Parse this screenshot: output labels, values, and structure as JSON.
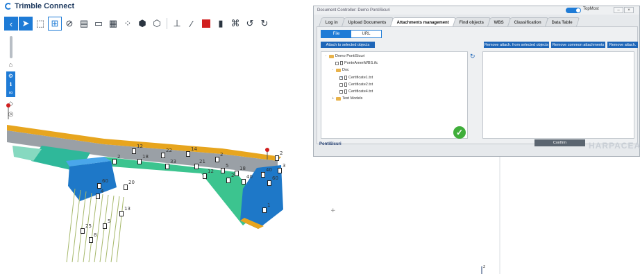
{
  "app": {
    "title": "Trimble Connect"
  },
  "toolbar": {
    "icons": [
      "chevron-left-icon",
      "pointer-icon",
      "box-select-icon",
      "object-select-icon",
      "hide-icon",
      "clip-icon",
      "measure-icon",
      "grid-icon",
      "explode-icon",
      "paint-icon",
      "cube-icon",
      "ruler-icon",
      "pen-icon",
      "color-icon",
      "layers-icon",
      "markup-icon",
      "undo-icon",
      "redo-icon"
    ],
    "color_swatch": "#d11f1f"
  },
  "dialog": {
    "title": "Document Controller: Demo PontiSicuri",
    "topmost_label": "TopMost",
    "tabs": [
      "Log in",
      "Upload Documents",
      "Attachments management",
      "Find objects",
      "WBS",
      "Classification",
      "Data Table"
    ],
    "active_tab": "Attachments management",
    "segment": {
      "file": "File",
      "url": "URL"
    },
    "attach_button": "Attach to selected objects",
    "remove_selected_button": "Remove attach. from selected objects",
    "remove_common_button": "Remove common attachments",
    "remove_button": "Remove attach.",
    "tree": [
      {
        "label": "Demo PontiSicuri",
        "type": "folder",
        "expanded": "-"
      },
      {
        "label": "PonteAmeriWBS.ifc",
        "type": "file"
      },
      {
        "label": "Doc",
        "type": "folder",
        "expanded": "-"
      },
      {
        "label": "Certificate1.txt",
        "type": "file",
        "checked": "✓"
      },
      {
        "label": "Certificate2.txt",
        "type": "file"
      },
      {
        "label": "Certificate4.txt",
        "type": "file"
      },
      {
        "label": "Test Models",
        "type": "folder",
        "expanded": "+"
      }
    ],
    "confirm_button": "Confirm",
    "brand_left": "PontiSicuri",
    "brand_right": "HARPACEAS"
  },
  "scene": {
    "counts": [
      "12",
      "2",
      "18",
      "22",
      "14",
      "33",
      "2",
      "21",
      "12",
      "5",
      "18",
      "2",
      "40",
      "3",
      "2",
      "60",
      "40",
      "20",
      "60",
      "13",
      "4",
      "5",
      "25",
      "8",
      "1"
    ],
    "axis_label": "z"
  }
}
